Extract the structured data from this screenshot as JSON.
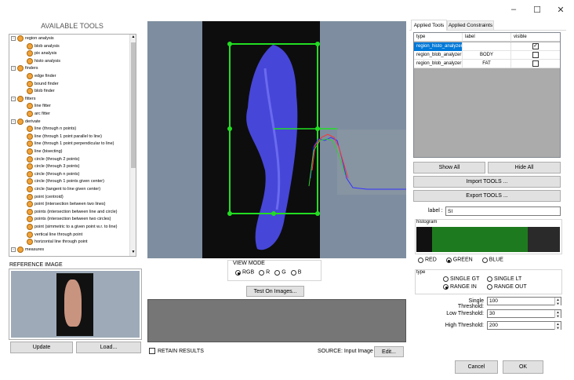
{
  "window": {
    "minimize": "–",
    "maximize": "☐",
    "close": "✕"
  },
  "tools_panel": {
    "title": "AVAILABLE TOOLS",
    "tree": [
      {
        "label": "region analysis",
        "level": 0,
        "expander": "-"
      },
      {
        "label": "blob analysis",
        "level": 1
      },
      {
        "label": "pix analysis",
        "level": 1
      },
      {
        "label": "histo analysis",
        "level": 1
      },
      {
        "label": "finders",
        "level": 0,
        "expander": "-"
      },
      {
        "label": "edge finder",
        "level": 1
      },
      {
        "label": "bound finder",
        "level": 1
      },
      {
        "label": "blob finder",
        "level": 1
      },
      {
        "label": "fitters",
        "level": 0,
        "expander": "-"
      },
      {
        "label": "line fitter",
        "level": 1
      },
      {
        "label": "arc fitter",
        "level": 1
      },
      {
        "label": "derivate",
        "level": 0,
        "expander": "-"
      },
      {
        "label": "line (through n points)",
        "level": 1
      },
      {
        "label": "line (through 1 point parallel to line)",
        "level": 1
      },
      {
        "label": "line (through 1 point perpendicular to line)",
        "level": 1
      },
      {
        "label": "line (bisecting)",
        "level": 1
      },
      {
        "label": "circle (through 2 points)",
        "level": 1
      },
      {
        "label": "circle (through 3 points)",
        "level": 1
      },
      {
        "label": "circle (through n points)",
        "level": 1
      },
      {
        "label": "circle (through 1 points given center)",
        "level": 1
      },
      {
        "label": "circle (tangent to line given center)",
        "level": 1
      },
      {
        "label": "point (centroid)",
        "level": 1
      },
      {
        "label": "point (intersection between two lines)",
        "level": 1
      },
      {
        "label": "points (intersection between line and circle)",
        "level": 1
      },
      {
        "label": "points (intersection between two circles)",
        "level": 1
      },
      {
        "label": "point (simmetric to a given point w.r. to line)",
        "level": 1
      },
      {
        "label": "vertical line through point",
        "level": 1
      },
      {
        "label": "horizontal line through point",
        "level": 1
      },
      {
        "label": "measures",
        "level": 0,
        "expander": "-"
      }
    ]
  },
  "reference": {
    "title": "REFERENCE IMAGE",
    "update_label": "Update",
    "load_label": "Load..."
  },
  "center": {
    "view_mode_title": "VIEW MODE",
    "view_modes": [
      "RGB",
      "R",
      "G",
      "B"
    ],
    "view_mode_selected": "RGB",
    "test_label": "Test On Images...",
    "retain_label": "RETAIN RESULTS",
    "source_label": "SOURCE: Input Image",
    "edit_label": "Edit..."
  },
  "right": {
    "tabs": [
      "Applied Tools",
      "Applied Constraints"
    ],
    "active_tab": "Applied Tools",
    "columns": [
      "type",
      "label",
      "visible"
    ],
    "rows": [
      {
        "type": "region_histo_analyzer",
        "label": "",
        "visible": true,
        "selected": true
      },
      {
        "type": "region_blob_analyzer",
        "label": "BODY",
        "visible": false,
        "selected": false
      },
      {
        "type": "region_blob_analyzer",
        "label": "FAT",
        "visible": false,
        "selected": false
      }
    ],
    "show_all": "Show All",
    "hide_all": "Hide All",
    "import_tools": "Import TOOLS ...",
    "export_tools": "Export TOOLS ...",
    "label_caption": "label :",
    "label_value": "SI",
    "histogram_title": "histogram",
    "channels": [
      "RED",
      "GREEN",
      "BLUE"
    ],
    "channel_selected": "GREEN",
    "type_title": "type",
    "type_options": [
      "SINGLE GT",
      "SINGLE LT",
      "RANGE IN",
      "RANGE OUT"
    ],
    "type_selected": "RANGE IN",
    "single_threshold_label": "Single Threshold:",
    "single_threshold": "100",
    "low_threshold_label": "Low Threshold:",
    "low_threshold": "30",
    "high_threshold_label": "High Threshold:",
    "high_threshold": "200",
    "cancel_label": "Cancel",
    "ok_label": "OK"
  },
  "colors": {
    "accent_select": "#0078d7",
    "roi_green": "#22dd22",
    "histogram_green": "#1e7a1e",
    "blob_blue": "#5050e0"
  }
}
